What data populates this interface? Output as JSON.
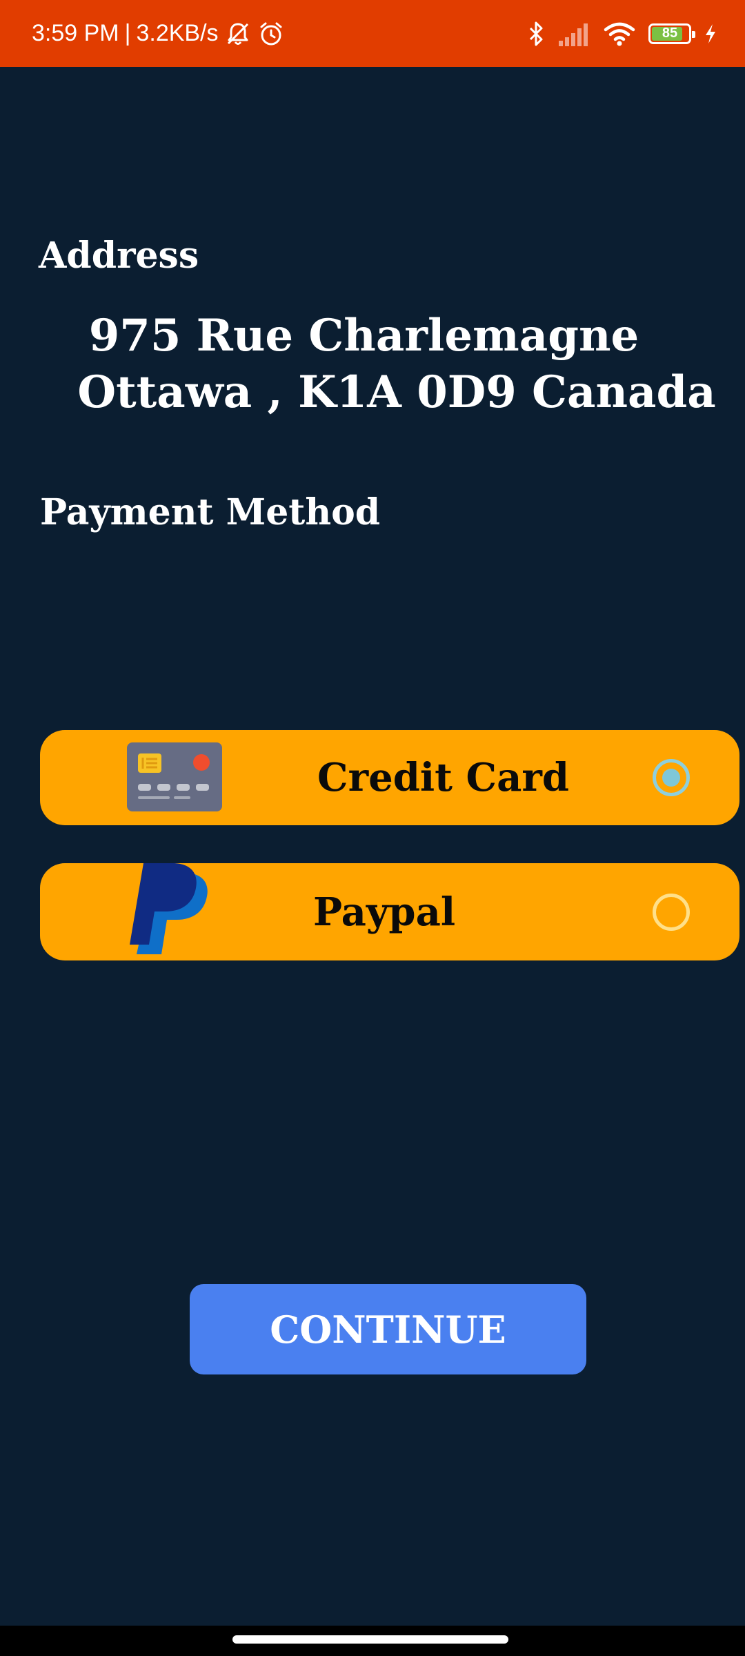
{
  "status_bar": {
    "time": "3:59 PM",
    "separator": "|",
    "network_speed": "3.2KB/s",
    "battery_level": "85",
    "battery_fraction": 0.85,
    "background_color": "#e13d00",
    "icons": [
      "bell-muted-icon",
      "alarm-icon",
      "bluetooth-icon",
      "signal-icon",
      "wifi-icon",
      "battery-icon",
      "charging-icon"
    ]
  },
  "address": {
    "title": "Address",
    "line1": "975 Rue Charlemagne",
    "line2": "Ottawa , K1A 0D9 Canada"
  },
  "payment": {
    "title": "Payment Method",
    "selected": "credit_card",
    "options": [
      {
        "id": "credit_card",
        "label": "Credit Card",
        "icon": "credit-card-icon",
        "selected": true
      },
      {
        "id": "paypal",
        "label": "Paypal",
        "icon": "paypal-icon",
        "selected": false
      }
    ],
    "option_color": "#ffa500"
  },
  "continue_button": {
    "label": "CONTINUE",
    "color": "#4a80f0"
  },
  "theme": {
    "background": "#0b1e31",
    "text": "#ffffff"
  }
}
